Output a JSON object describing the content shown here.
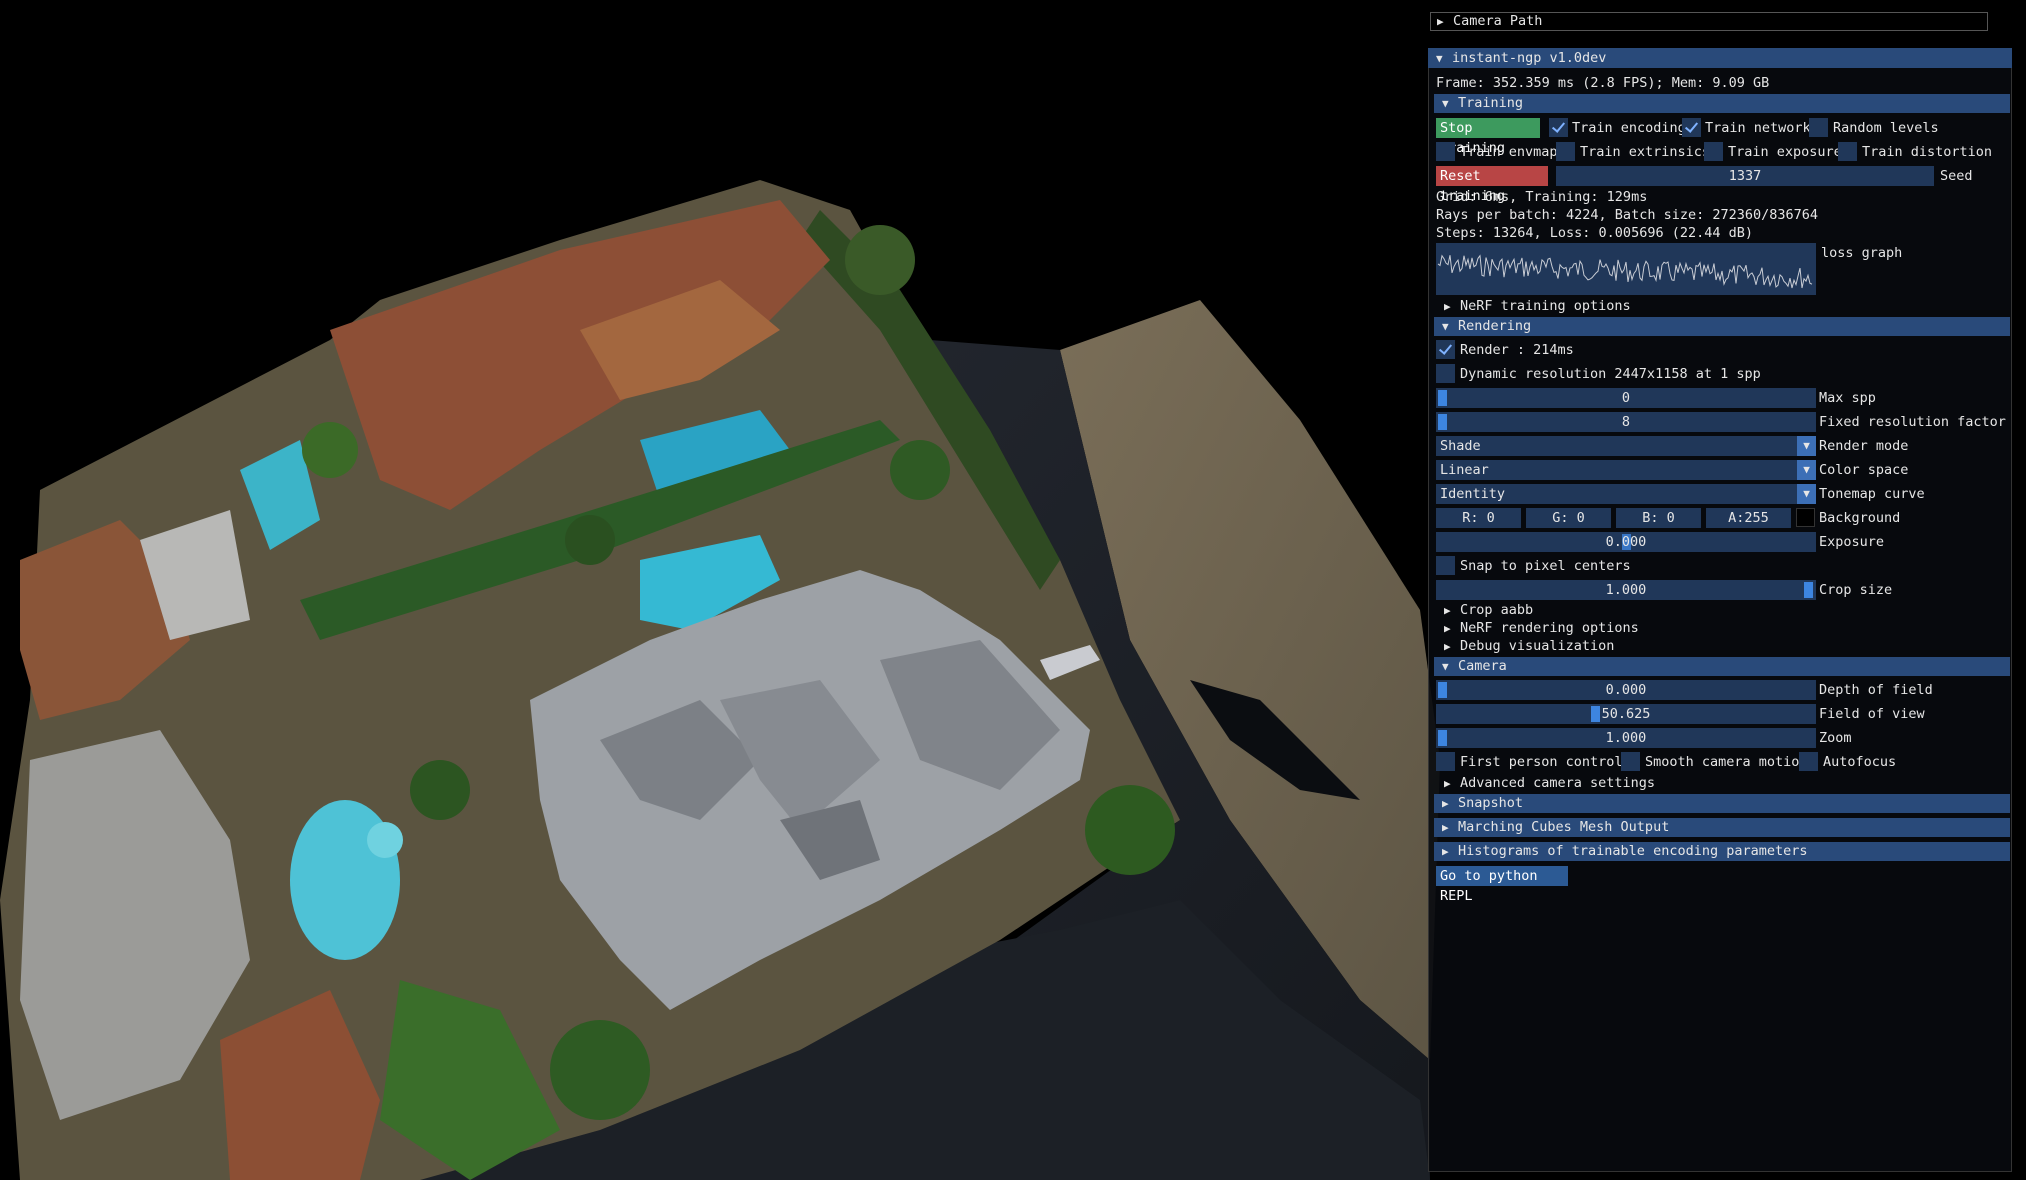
{
  "camera_path": {
    "title": "Camera Path"
  },
  "window": {
    "title": "instant-ngp v1.0dev",
    "frame_info": "Frame: 352.359 ms (2.8 FPS); Mem: 9.09 GB"
  },
  "training": {
    "header": "Training",
    "stop_button": "Stop training",
    "train_encoding": "Train encoding",
    "train_network": "Train network",
    "random_levels": "Random levels",
    "train_envmap": "Train envmap",
    "train_extrinsics": "Train extrinsics",
    "train_exposure": "Train exposure",
    "train_distortion": "Train distortion",
    "reset_button": "Reset training",
    "seed_value": "1337",
    "seed_label": "Seed",
    "stats1": "Grid: 6ms, Training: 129ms",
    "stats2": "Rays per batch: 4224, Batch size: 272360/836764",
    "stats3": "Steps: 13264, Loss: 0.005696 (22.44 dB)",
    "loss_graph_label": "loss graph",
    "nerf_training_options": "NeRF training options"
  },
  "rendering": {
    "header": "Rendering",
    "render_label": "Render : 214ms",
    "dynamic_res": "Dynamic resolution 2447x1158 at 1 spp",
    "max_spp_value": "0",
    "max_spp_label": "Max spp",
    "fixed_res_value": "8",
    "fixed_res_label": "Fixed resolution factor",
    "render_mode_value": "Shade",
    "render_mode_label": "Render mode",
    "color_space_value": "Linear",
    "color_space_label": "Color space",
    "tonemap_value": "Identity",
    "tonemap_label": "Tonemap curve",
    "bg_r": "R: 0",
    "bg_g": "G: 0",
    "bg_b": "B: 0",
    "bg_a": "A:255",
    "background_label": "Background",
    "exposure_value": "0.000",
    "exposure_label": "Exposure",
    "snap_label": "Snap to pixel centers",
    "crop_size_value": "1.000",
    "crop_size_label": "Crop size",
    "crop_aabb": "Crop aabb",
    "nerf_rendering_options": "NeRF rendering options",
    "debug_vis": "Debug visualization"
  },
  "camera": {
    "header": "Camera",
    "dof_value": "0.000",
    "dof_label": "Depth of field",
    "fov_value": "50.625",
    "fov_label": "Field of view",
    "zoom_value": "1.000",
    "zoom_label": "Zoom",
    "first_person": "First person controls",
    "smooth_motion": "Smooth camera motion",
    "autofocus": "Autofocus",
    "advanced": "Advanced camera settings"
  },
  "sections": {
    "snapshot": "Snapshot",
    "marching_cubes": "Marching Cubes Mesh Output",
    "histograms": "Histograms of trainable encoding parameters"
  },
  "python_button": "Go to python REPL",
  "colors": {
    "header": "#294a7a",
    "frame": "#203759",
    "accent": "#3d85e0",
    "stop_btn": "#3d9a5e",
    "reset_btn": "#b84545"
  },
  "icons": {
    "expanded": "triangle-down-icon",
    "collapsed": "triangle-right-icon",
    "check": "check-icon",
    "combo": "combo-arrow-icon"
  }
}
